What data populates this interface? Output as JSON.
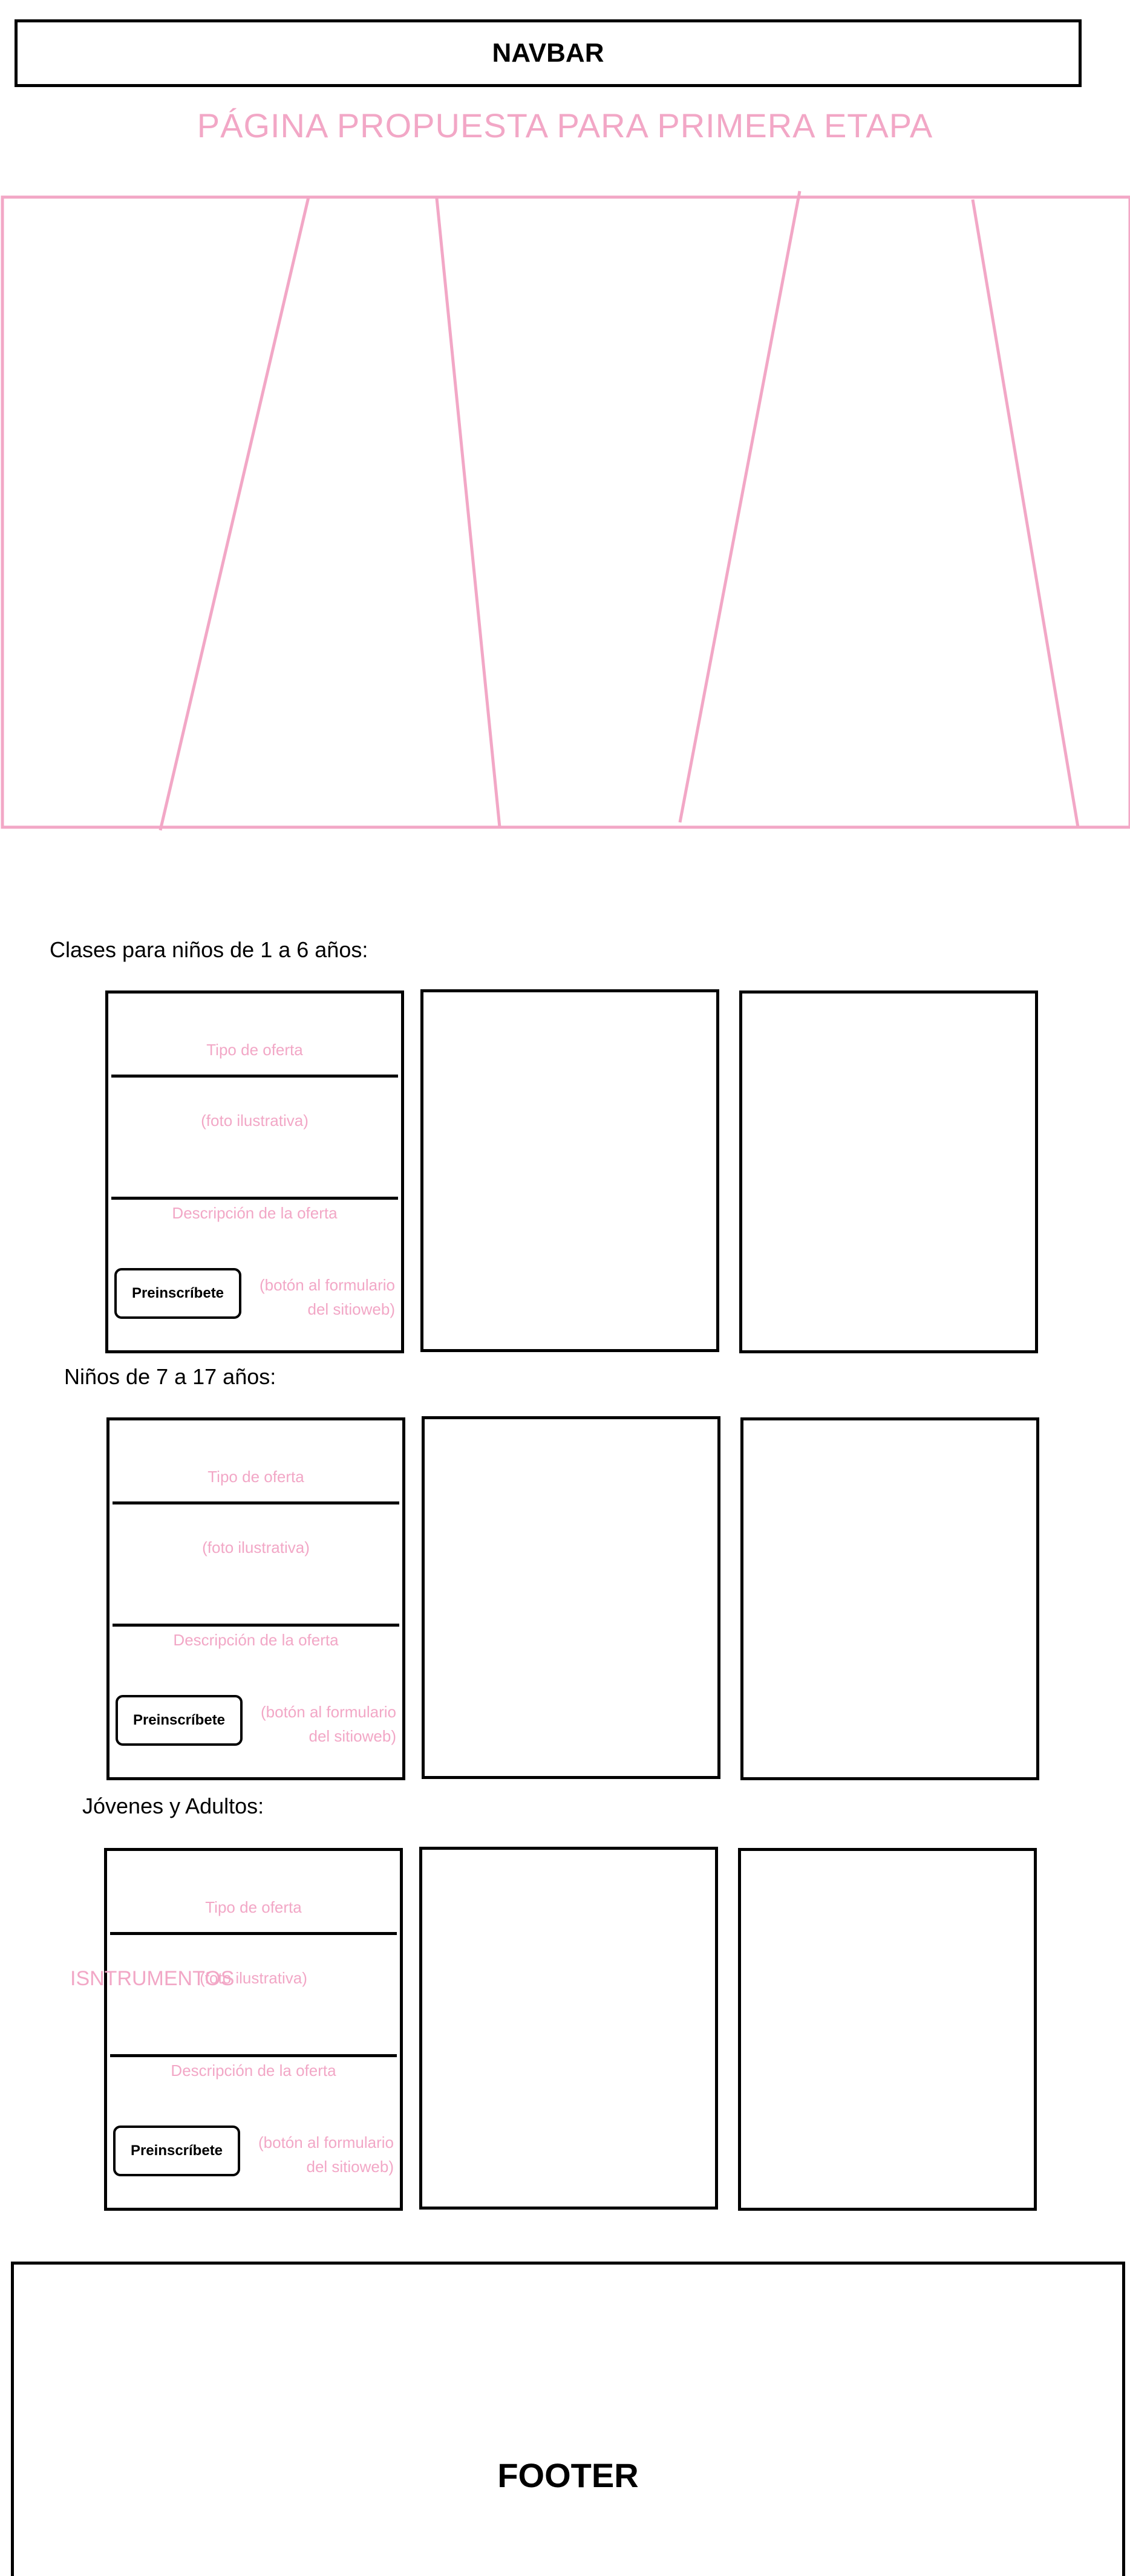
{
  "navbar": {
    "label": "NAVBAR"
  },
  "page_title": "PÁGINA PROPUESTA PARA PRIMERA ETAPA",
  "colors": {
    "accent_pink": "#f2a7c6",
    "border": "#000000"
  },
  "sections": [
    {
      "heading": "Clases para niños de 1 a 6 años:",
      "card": {
        "type_label": "Tipo de oferta",
        "photo_label": "(foto ilustrativa)",
        "description_label": "Descripción de la oferta",
        "button_label": "Preinscríbete",
        "button_note_line1": "(botón al formulario",
        "button_note_line2": "del sitioweb)"
      }
    },
    {
      "heading": "Niños de 7 a 17 años:",
      "card": {
        "type_label": "Tipo de oferta",
        "photo_label": "(foto ilustrativa)",
        "description_label": "Descripción de la oferta",
        "button_label": "Preinscríbete",
        "button_note_line1": "(botón al formulario",
        "button_note_line2": "del sitioweb)"
      }
    },
    {
      "heading": "Jóvenes y Adultos:",
      "card": {
        "type_label": "Tipo de oferta",
        "photo_label": "(foto ilustrativa)",
        "description_label": "Descripción de la oferta",
        "button_label": "Preinscríbete",
        "button_note_line1": "(botón al formulario",
        "button_note_line2": "del sitioweb)"
      }
    }
  ],
  "instruments_label": "ISNTRUMENTOS",
  "footer": {
    "label": "FOOTER"
  }
}
